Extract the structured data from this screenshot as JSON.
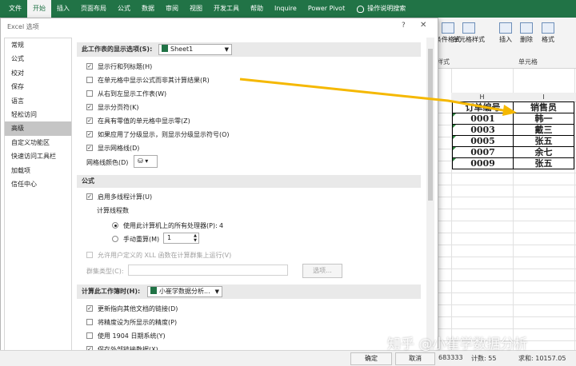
{
  "ribbon": {
    "tabs": [
      "文件",
      "开始",
      "插入",
      "页面布局",
      "公式",
      "数据",
      "审阅",
      "视图",
      "开发工具",
      "帮助",
      "Inquire",
      "Power Pivot"
    ],
    "active_tab": 1,
    "search": "操作说明搜索",
    "buttons": {
      "conditional": "条件格式",
      "cell_style": "单元格样式",
      "insert": "插入",
      "delete": "删除",
      "format": "格式",
      "style_group": "样式",
      "cells_group": "单元格"
    }
  },
  "sheet": {
    "columns": [
      "H",
      "I",
      "J"
    ],
    "headers": [
      "订单编号",
      "销售员"
    ],
    "rows": [
      [
        "0001",
        "韩一"
      ],
      [
        "0003",
        "戴三"
      ],
      [
        "0005",
        "张五"
      ],
      [
        "0007",
        "余七"
      ],
      [
        "0009",
        "张五"
      ]
    ]
  },
  "dialog": {
    "title": "Excel 选项",
    "help": "?",
    "close": "✕",
    "nav": [
      "常规",
      "公式",
      "校对",
      "保存",
      "语言",
      "轻松访问",
      "高级",
      "自定义功能区",
      "快速访问工具栏",
      "加载项",
      "信任中心"
    ],
    "nav_selected": 6,
    "sheet_section": {
      "label": "此工作表的显示选项(S):",
      "sheet": "Sheet1",
      "options": [
        {
          "label": "显示行和列标题(H)",
          "checked": true
        },
        {
          "label": "在单元格中显示公式而非其计算结果(R)",
          "checked": false
        },
        {
          "label": "从右到左显示工作表(W)",
          "checked": false
        },
        {
          "label": "显示分页符(K)",
          "checked": true
        },
        {
          "label": "在具有零值的单元格中显示零(Z)",
          "checked": true
        },
        {
          "label": "如果应用了分级显示，则显示分级显示符号(O)",
          "checked": true
        },
        {
          "label": "显示网格线(D)",
          "checked": true
        }
      ],
      "gridline_color": "网格线颜色(D)"
    },
    "formula_section": {
      "title": "公式",
      "multithread": "启用多线程计算(U)",
      "thread_count": "计算线程数",
      "use_all": "使用此计算机上的所有处理器(P):",
      "processor_count": "4",
      "manual": "手动重算(M)",
      "manual_value": "1",
      "xll": "允许用户定义的 XLL 函数在计算群集上运行(V)",
      "cluster_type": "群集类型(C):",
      "options_btn": "选项..."
    },
    "workbook_section": {
      "label": "计算此工作簿时(H):",
      "workbook": "小崔学数据分析...",
      "options": [
        {
          "label": "更新指向其他文档的链接(D)",
          "checked": true,
          "disabled": false
        },
        {
          "label": "将精度设为所显示的精度(P)",
          "checked": false,
          "disabled": false
        },
        {
          "label": "使用 1904 日期系统(Y)",
          "checked": false,
          "disabled": false
        },
        {
          "label": "保存外部链接数据(X)",
          "checked": true,
          "disabled": false
        }
      ]
    },
    "ok": "确定",
    "cancel": "取消"
  },
  "status": {
    "avg": "683333",
    "count": "计数: 55",
    "sum": "求和: 10157.05"
  },
  "watermark": "知乎 @小崔学数据分析",
  "colors": {
    "excel_green": "#217346",
    "arrow": "#f5b800"
  }
}
